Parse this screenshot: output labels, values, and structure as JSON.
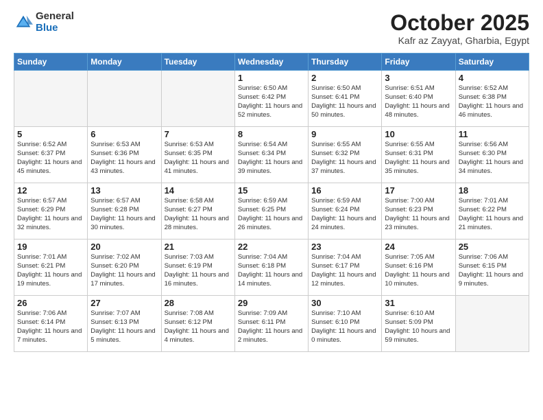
{
  "header": {
    "logo_general": "General",
    "logo_blue": "Blue",
    "month_title": "October 2025",
    "location": "Kafr az Zayyat, Gharbia, Egypt"
  },
  "days_of_week": [
    "Sunday",
    "Monday",
    "Tuesday",
    "Wednesday",
    "Thursday",
    "Friday",
    "Saturday"
  ],
  "weeks": [
    [
      {
        "day": "",
        "empty": true
      },
      {
        "day": "",
        "empty": true
      },
      {
        "day": "",
        "empty": true
      },
      {
        "day": "1",
        "sunrise": "6:50 AM",
        "sunset": "6:42 PM",
        "daylight": "11 hours and 52 minutes."
      },
      {
        "day": "2",
        "sunrise": "6:50 AM",
        "sunset": "6:41 PM",
        "daylight": "11 hours and 50 minutes."
      },
      {
        "day": "3",
        "sunrise": "6:51 AM",
        "sunset": "6:40 PM",
        "daylight": "11 hours and 48 minutes."
      },
      {
        "day": "4",
        "sunrise": "6:52 AM",
        "sunset": "6:38 PM",
        "daylight": "11 hours and 46 minutes."
      }
    ],
    [
      {
        "day": "5",
        "sunrise": "6:52 AM",
        "sunset": "6:37 PM",
        "daylight": "11 hours and 45 minutes."
      },
      {
        "day": "6",
        "sunrise": "6:53 AM",
        "sunset": "6:36 PM",
        "daylight": "11 hours and 43 minutes."
      },
      {
        "day": "7",
        "sunrise": "6:53 AM",
        "sunset": "6:35 PM",
        "daylight": "11 hours and 41 minutes."
      },
      {
        "day": "8",
        "sunrise": "6:54 AM",
        "sunset": "6:34 PM",
        "daylight": "11 hours and 39 minutes."
      },
      {
        "day": "9",
        "sunrise": "6:55 AM",
        "sunset": "6:32 PM",
        "daylight": "11 hours and 37 minutes."
      },
      {
        "day": "10",
        "sunrise": "6:55 AM",
        "sunset": "6:31 PM",
        "daylight": "11 hours and 35 minutes."
      },
      {
        "day": "11",
        "sunrise": "6:56 AM",
        "sunset": "6:30 PM",
        "daylight": "11 hours and 34 minutes."
      }
    ],
    [
      {
        "day": "12",
        "sunrise": "6:57 AM",
        "sunset": "6:29 PM",
        "daylight": "11 hours and 32 minutes."
      },
      {
        "day": "13",
        "sunrise": "6:57 AM",
        "sunset": "6:28 PM",
        "daylight": "11 hours and 30 minutes."
      },
      {
        "day": "14",
        "sunrise": "6:58 AM",
        "sunset": "6:27 PM",
        "daylight": "11 hours and 28 minutes."
      },
      {
        "day": "15",
        "sunrise": "6:59 AM",
        "sunset": "6:25 PM",
        "daylight": "11 hours and 26 minutes."
      },
      {
        "day": "16",
        "sunrise": "6:59 AM",
        "sunset": "6:24 PM",
        "daylight": "11 hours and 24 minutes."
      },
      {
        "day": "17",
        "sunrise": "7:00 AM",
        "sunset": "6:23 PM",
        "daylight": "11 hours and 23 minutes."
      },
      {
        "day": "18",
        "sunrise": "7:01 AM",
        "sunset": "6:22 PM",
        "daylight": "11 hours and 21 minutes."
      }
    ],
    [
      {
        "day": "19",
        "sunrise": "7:01 AM",
        "sunset": "6:21 PM",
        "daylight": "11 hours and 19 minutes."
      },
      {
        "day": "20",
        "sunrise": "7:02 AM",
        "sunset": "6:20 PM",
        "daylight": "11 hours and 17 minutes."
      },
      {
        "day": "21",
        "sunrise": "7:03 AM",
        "sunset": "6:19 PM",
        "daylight": "11 hours and 16 minutes."
      },
      {
        "day": "22",
        "sunrise": "7:04 AM",
        "sunset": "6:18 PM",
        "daylight": "11 hours and 14 minutes."
      },
      {
        "day": "23",
        "sunrise": "7:04 AM",
        "sunset": "6:17 PM",
        "daylight": "11 hours and 12 minutes."
      },
      {
        "day": "24",
        "sunrise": "7:05 AM",
        "sunset": "6:16 PM",
        "daylight": "11 hours and 10 minutes."
      },
      {
        "day": "25",
        "sunrise": "7:06 AM",
        "sunset": "6:15 PM",
        "daylight": "11 hours and 9 minutes."
      }
    ],
    [
      {
        "day": "26",
        "sunrise": "7:06 AM",
        "sunset": "6:14 PM",
        "daylight": "11 hours and 7 minutes."
      },
      {
        "day": "27",
        "sunrise": "7:07 AM",
        "sunset": "6:13 PM",
        "daylight": "11 hours and 5 minutes."
      },
      {
        "day": "28",
        "sunrise": "7:08 AM",
        "sunset": "6:12 PM",
        "daylight": "11 hours and 4 minutes."
      },
      {
        "day": "29",
        "sunrise": "7:09 AM",
        "sunset": "6:11 PM",
        "daylight": "11 hours and 2 minutes."
      },
      {
        "day": "30",
        "sunrise": "7:10 AM",
        "sunset": "6:10 PM",
        "daylight": "11 hours and 0 minutes."
      },
      {
        "day": "31",
        "sunrise": "6:10 AM",
        "sunset": "5:09 PM",
        "daylight": "10 hours and 59 minutes."
      },
      {
        "day": "",
        "empty": true
      }
    ]
  ],
  "labels": {
    "sunrise": "Sunrise:",
    "sunset": "Sunset:",
    "daylight": "Daylight:"
  }
}
